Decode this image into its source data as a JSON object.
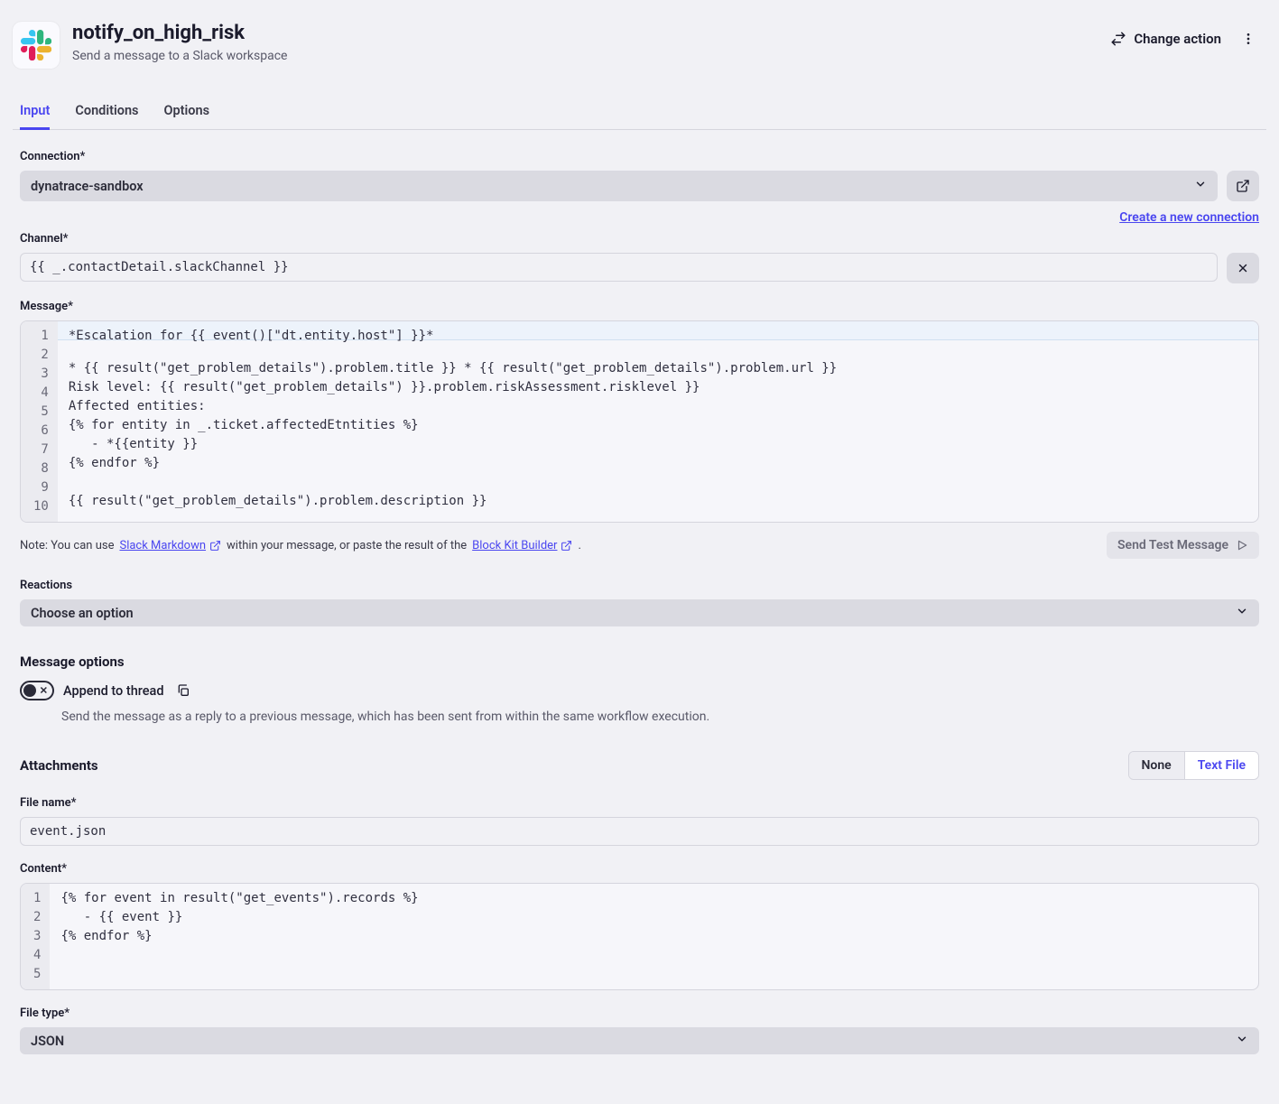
{
  "header": {
    "title": "notify_on_high_risk",
    "subtitle": "Send a message to a Slack workspace",
    "changeAction": "Change action"
  },
  "tabs": [
    "Input",
    "Conditions",
    "Options"
  ],
  "activeTab": 0,
  "connection": {
    "label": "Connection*",
    "selected": "dynatrace-sandbox",
    "createLink": "Create a new connection"
  },
  "channel": {
    "label": "Channel*",
    "value": "{{ _.contactDetail.slackChannel }}"
  },
  "message": {
    "label": "Message*",
    "lines": [
      "*Escalation for {{ event()[\"dt.entity.host\"] }}*",
      "",
      "* {{ result(\"get_problem_details\").problem.title }} * {{ result(\"get_problem_details\").problem.url }}",
      "Risk level: {{ result(\"get_problem_details\") }}.problem.riskAssessment.risklevel }}",
      "Affected entities:",
      "{% for entity in _.ticket.affectedEtntities %}",
      "   - *{{entity }}",
      "{% endfor %}",
      "",
      "{{ result(\"get_problem_details\").problem.description }}"
    ]
  },
  "note": {
    "prefix": "Note: You can use ",
    "link1": "Slack Markdown",
    "middle": " within your message, or paste the result of the ",
    "link2": "Block Kit Builder",
    "suffix": ".",
    "sendTest": "Send Test Message"
  },
  "reactions": {
    "label": "Reactions",
    "placeholder": "Choose an option"
  },
  "messageOptions": {
    "heading": "Message options",
    "appendToThread": {
      "label": "Append to thread",
      "on": false,
      "help": "Send the message as a reply to a previous message, which has been sent from within the same workflow execution."
    }
  },
  "attachments": {
    "label": "Attachments",
    "options": [
      "None",
      "Text File"
    ],
    "active": 1
  },
  "fileName": {
    "label": "File name*",
    "value": "event.json"
  },
  "content": {
    "label": "Content*",
    "lines": [
      "{% for event in result(\"get_events\").records %}",
      "   - {{ event }}",
      "{% endfor %}",
      "",
      ""
    ]
  },
  "fileType": {
    "label": "File type*",
    "selected": "JSON"
  }
}
